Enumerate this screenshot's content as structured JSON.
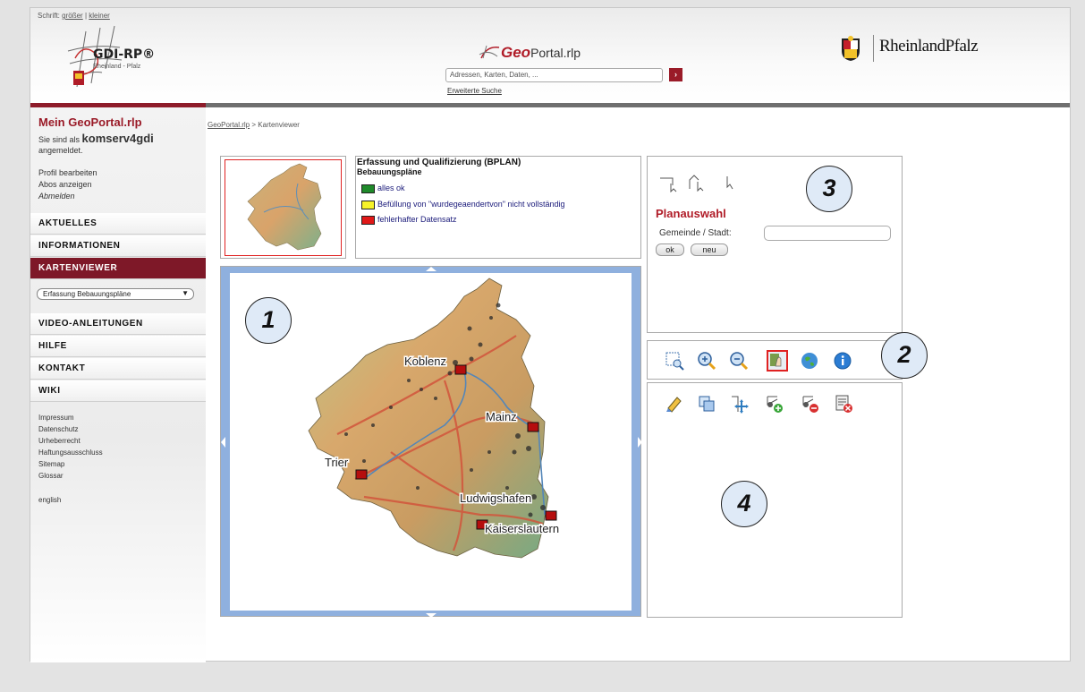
{
  "header": {
    "font_size_label": "Schrift:",
    "font_bigger": "größer",
    "font_separator": "|",
    "font_smaller": "kleiner",
    "gdi_logo_text": "GDI-RP®",
    "gdi_logo_sub": "Rheinland - Pfalz",
    "geoportal_geo": "Geo",
    "geoportal_portal": "Portal.rlp",
    "search_placeholder": "Adressen, Karten, Daten, ...",
    "search_button_glyph": "›",
    "advanced_search": "Erweiterte Suche",
    "rlp_text": "RheinlandPfalz"
  },
  "sidebar": {
    "title": "Mein GeoPortal.rlp",
    "login_prefix": "Sie sind als",
    "username": "komserv4gdi",
    "login_suffix": "angemeldet.",
    "links": [
      "Profil bearbeiten",
      "Abos anzeigen",
      "Abmelden"
    ],
    "nav": [
      "AKTUELLES",
      "INFORMATIONEN",
      "KARTENVIEWER",
      "VIDEO-ANLEITUNGEN",
      "HILFE",
      "KONTAKT",
      "WIKI"
    ],
    "select_value": "Erfassung Bebauungspläne",
    "footer_links": [
      "Impressum",
      "Datenschutz",
      "Urheberrecht",
      "Haftungsausschluss",
      "Sitemap",
      "Glossar",
      "english"
    ]
  },
  "breadcrumb": {
    "home": "GeoPortal.rlp",
    "separator": ">",
    "current": "Kartenviewer"
  },
  "legend": {
    "title": "Erfassung und Qualifizierung (BPLAN)",
    "subtitle": "Bebauungspläne",
    "items": [
      {
        "label": "alles ok",
        "color": "#1f8a2a"
      },
      {
        "label": "Befüllung von \"wurdegeaendertvon\" nicht vollständig",
        "color": "#f6f22a"
      },
      {
        "label": "fehlerhafter Datensatz",
        "color": "#e01818"
      }
    ]
  },
  "map": {
    "cities": [
      "Koblenz",
      "Mainz",
      "Trier",
      "Ludwigshafen",
      "Kaiserslautern"
    ]
  },
  "plan": {
    "title": "Planauswahl",
    "gemeinde_label": "Gemeinde / Stadt:",
    "ok_label": "ok",
    "neu_label": "neu"
  },
  "callouts": [
    "1",
    "2",
    "3",
    "4"
  ],
  "colors": {
    "accent": "#9a1b28",
    "map_frame": "#8fb0de"
  }
}
